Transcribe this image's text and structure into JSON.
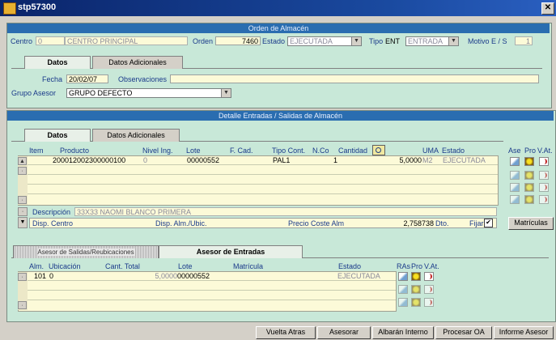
{
  "window": {
    "title": "stp57300",
    "close": "✕"
  },
  "orden": {
    "header": "Orden de Almacén",
    "centro_label": "Centro",
    "centro_code": "0",
    "centro_name": "CENTRO PRINCIPAL",
    "orden_label": "Orden",
    "orden_value": "7460",
    "estado_label": "Estado",
    "estado_value": "EJECUTADA",
    "tipo_label": "Tipo",
    "tipo_code": "ENT",
    "tipo_value": "ENTRADA",
    "motivo_label": "Motivo E / S",
    "motivo_value": "1",
    "tabs": [
      "Datos",
      "Datos Adicionales"
    ],
    "fecha_label": "Fecha",
    "fecha_value": "20/02/07",
    "obs_label": "Observaciones",
    "obs_value": "",
    "grupo_label": "Grupo Asesor",
    "grupo_value": "GRUPO DEFECTO"
  },
  "detalle": {
    "header": "Detalle Entradas / Salidas de Almacén",
    "tabs": [
      "Datos",
      "Datos Adicionales"
    ],
    "columns": {
      "item": "Item",
      "producto": "Producto",
      "nivel": "Nivel Ing.",
      "lote": "Lote",
      "fcad": "F. Cad.",
      "tipocont": "Tipo Cont.",
      "nco": "N.Co",
      "cantidad": "Cantidad",
      "uma": "UMA",
      "estado": "Estado"
    },
    "rows": [
      {
        "item": "20",
        "producto": "0012002300000100",
        "nivel": "0",
        "lote": "00000552",
        "fcad": "",
        "tipocont": "PAL1",
        "nco": "1",
        "cantidad": "5,0000",
        "uma": "M2",
        "estado": "EJECUTADA"
      }
    ],
    "side_labels": {
      "ase": "Ase",
      "pro": "Pro",
      "vat": "V.At."
    },
    "descripcion_label": "Descripción",
    "descripcion_value": "33X33 NAOMI BLANCO PRIMERA",
    "disp_centro_label": "Disp. Centro",
    "disp_alm_label": "Disp. Alm./Ubic.",
    "precio_label": "Precio Coste Alm",
    "precio_value": "2,758738",
    "dto_label": "Dto.",
    "fijar_label": "Fijar",
    "fijar_checked": "✔",
    "matriculas_button": "Matrículas"
  },
  "asesor": {
    "tabs": [
      "Asesor de Salidas/Reubicaciones",
      "Asesor de Entradas"
    ],
    "columns": {
      "alm": "Alm.",
      "ubicacion": "Ubicación",
      "cant": "Cant. Total",
      "lote": "Lote",
      "matricula": "Matrícula",
      "estado": "Estado",
      "ras": "RAs",
      "pro": "Pro",
      "vat": "V.At."
    },
    "rows": [
      {
        "alm": "101",
        "ubicacion": "0",
        "cant": "5,0000",
        "lote": "00000552",
        "matricula": "",
        "estado": "EJECUTADA"
      }
    ]
  },
  "buttons": [
    "Vuelta Atras",
    "Asesorar",
    "Albarán Interno",
    "Procesar OA",
    "Informe Asesor"
  ]
}
